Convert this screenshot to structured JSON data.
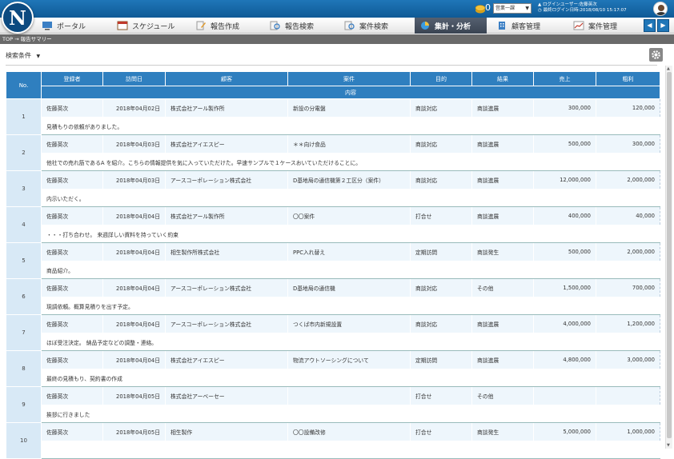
{
  "header": {
    "logo_letter": "N",
    "coin_count": "0",
    "role_select": "営業一課",
    "login_user": "ログインユーザー:佐藤英次",
    "last_login": "最終ログイン日時:2018/08/10 15:17:07"
  },
  "nav": {
    "items": [
      {
        "label": "ポータル"
      },
      {
        "label": "スケジュール"
      },
      {
        "label": "報告作成"
      },
      {
        "label": "報告検索"
      },
      {
        "label": "案件検索"
      },
      {
        "label": "集計・分析"
      },
      {
        "label": "顧客管理"
      },
      {
        "label": "案件管理"
      }
    ],
    "active": "集計・分析"
  },
  "breadcrumb": "TOP → 報告サマリー",
  "search_conditions": "検索条件",
  "table": {
    "headers": {
      "no": "No.",
      "registrant": "登録者",
      "visit_date": "訪問日",
      "customer": "顧客",
      "project": "案件",
      "purpose": "目的",
      "result": "結果",
      "sales": "売上",
      "profit": "粗利",
      "content": "内容"
    },
    "rows": [
      {
        "no": "1",
        "registrant": "佐藤英次",
        "date": "2018年04月02日",
        "customer": "株式会社アール製作所",
        "project": "新設の分電盤",
        "purpose": "商談対応",
        "result": "商談進展",
        "sales": "300,000",
        "profit": "120,000",
        "content": "見積もりの依頼がありました。"
      },
      {
        "no": "2",
        "registrant": "佐藤英次",
        "date": "2018年04月03日",
        "customer": "株式会社アイエスピー",
        "project": "＊＊向け食品",
        "purpose": "商談対応",
        "result": "商談進展",
        "sales": "500,000",
        "profit": "300,000",
        "content": "他社での売れ筋であるA を紹介。こちらの情報提供を気に入っていただけた。早速サンプルで１ケースおいていただけることに。"
      },
      {
        "no": "3",
        "registrant": "佐藤英次",
        "date": "2018年04月03日",
        "customer": "アースコーポレーション株式会社",
        "project": "D基地局の通信機第２工区分（案件）",
        "purpose": "商談対応",
        "result": "商談進展",
        "sales": "12,000,000",
        "profit": "2,000,000",
        "content": "内示いただく。"
      },
      {
        "no": "4",
        "registrant": "佐藤英次",
        "date": "2018年04月04日",
        "customer": "株式会社アール製作所",
        "project": "〇〇案件",
        "purpose": "打合せ",
        "result": "商談進展",
        "sales": "400,000",
        "profit": "40,000",
        "content": "・・・打ち合わせ。 来週詳しい資料を持っていく約束"
      },
      {
        "no": "5",
        "registrant": "佐藤英次",
        "date": "2018年04月04日",
        "customer": "相生製作所株式会社",
        "project": "PPC入れ替え",
        "purpose": "定期訪問",
        "result": "商談発生",
        "sales": "500,000",
        "profit": "2,000,000",
        "content": "商品紹介。"
      },
      {
        "no": "6",
        "registrant": "佐藤英次",
        "date": "2018年04月04日",
        "customer": "アースコーポレーション株式会社",
        "project": "D基地局の通信機",
        "purpose": "商談対応",
        "result": "その他",
        "sales": "1,500,000",
        "profit": "700,000",
        "content": "現調依頼。概算見積りを出す予定。"
      },
      {
        "no": "7",
        "registrant": "佐藤英次",
        "date": "2018年04月04日",
        "customer": "アースコーポレーション株式会社",
        "project": "つくば市内新規設置",
        "purpose": "商談対応",
        "result": "商談進展",
        "sales": "4,000,000",
        "profit": "1,200,000",
        "content": "ほぼ受注決定。 納品予定などの調整・連絡。"
      },
      {
        "no": "8",
        "registrant": "佐藤英次",
        "date": "2018年04月04日",
        "customer": "株式会社アイエスピー",
        "project": "物流アウトソーシングについて",
        "purpose": "定期訪問",
        "result": "商談進展",
        "sales": "4,800,000",
        "profit": "3,000,000",
        "content": "最終の見積もり、契約書の作成"
      },
      {
        "no": "9",
        "registrant": "佐藤英次",
        "date": "2018年04月05日",
        "customer": "株式会社アーベーセー",
        "project": "",
        "purpose": "打合せ",
        "result": "その他",
        "sales": "",
        "profit": "",
        "content": "挨拶に行きました"
      },
      {
        "no": "10",
        "registrant": "佐藤英次",
        "date": "2018年04月05日",
        "customer": "相生製作",
        "project": "〇〇設備改修",
        "purpose": "打合せ",
        "result": "商談発生",
        "sales": "5,000,000",
        "profit": "1,000,000",
        "content": ""
      }
    ]
  }
}
